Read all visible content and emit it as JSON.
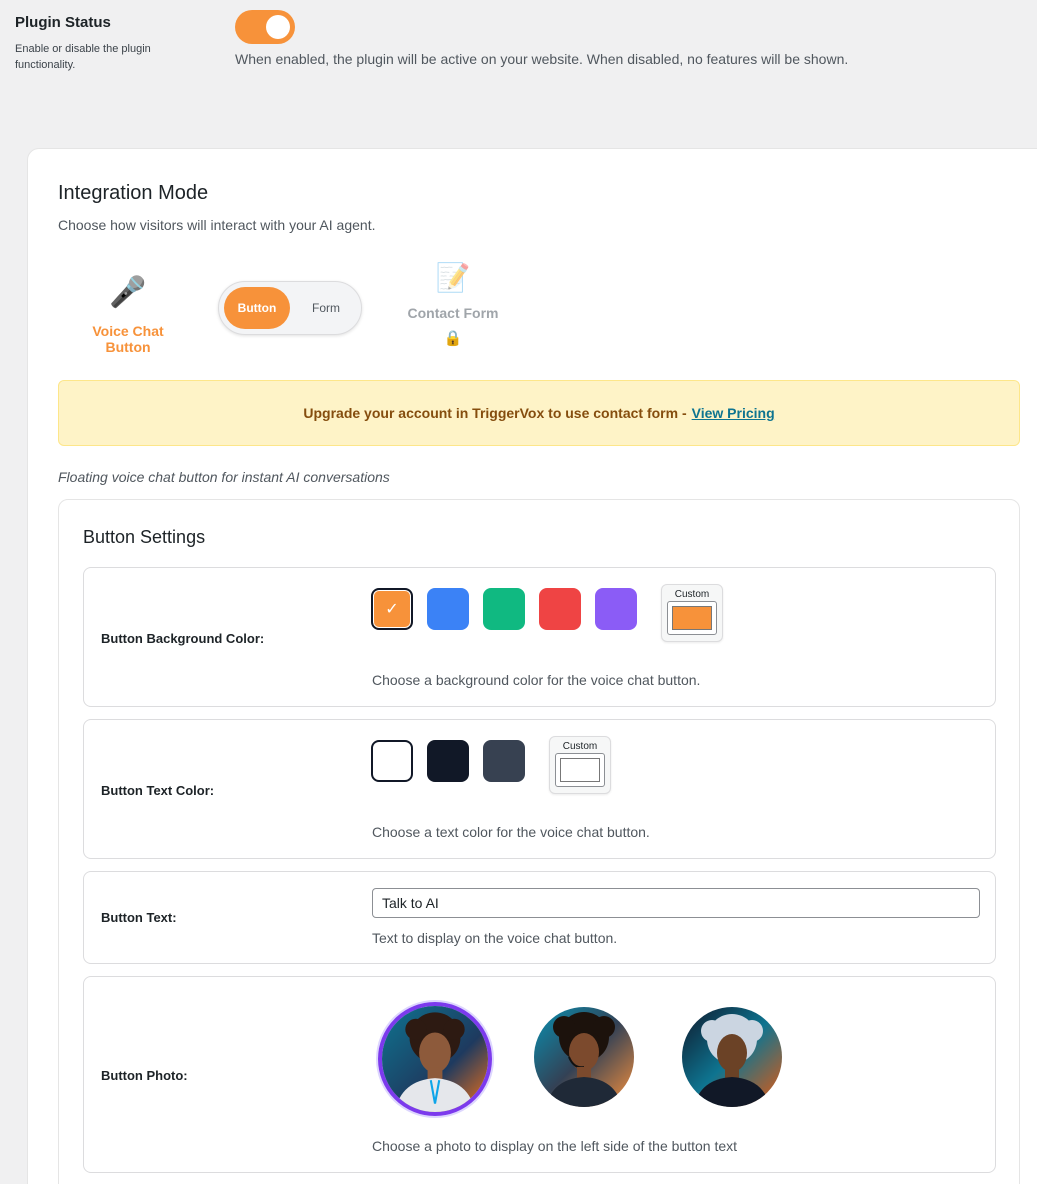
{
  "plugin_status": {
    "title": "Plugin Status",
    "description": "Enable or disable the plugin functionality.",
    "enabled": true,
    "help": "When enabled, the plugin will be active on your website. When disabled, no features will be shown."
  },
  "integration_mode": {
    "title": "Integration Mode",
    "description": "Choose how visitors will interact with your AI agent.",
    "voice_option": {
      "label": "Voice Chat Button",
      "icon": "microphone-icon",
      "glyph": "🎤"
    },
    "toggle": {
      "button_label": "Button",
      "form_label": "Form",
      "selected": "Button"
    },
    "form_option": {
      "label": "Contact Form",
      "icon": "form-icon",
      "glyph": "📝",
      "lock_glyph": "🔒"
    },
    "upgrade": {
      "text": "Upgrade your account in TriggerVox to use contact form -",
      "link_text": "View Pricing"
    },
    "floating_desc": "Floating voice chat button for instant AI conversations"
  },
  "button_settings": {
    "title": "Button Settings",
    "background_color": {
      "label": "Button Background Color:",
      "swatches": [
        "#f7923a",
        "#3b82f6",
        "#10b981",
        "#ef4444",
        "#8b5cf6"
      ],
      "selected": "#f7923a",
      "custom_label": "Custom",
      "custom_value": "#f7923a",
      "check_glyph": "✓",
      "help": "Choose a background color for the voice chat button."
    },
    "text_color": {
      "label": "Button Text Color:",
      "swatches": [
        "#ffffff",
        "#111827",
        "#374151"
      ],
      "selected": "#ffffff",
      "custom_label": "Custom",
      "custom_value": "#ffffff",
      "help": "Choose a text color for the voice chat button."
    },
    "button_text": {
      "label": "Button Text:",
      "value": "Talk to AI",
      "help": "Text to display on the voice chat button."
    },
    "button_photo": {
      "label": "Button Photo:",
      "selected_index": 0,
      "help": "Choose a photo to display on the left side of the button text"
    }
  }
}
